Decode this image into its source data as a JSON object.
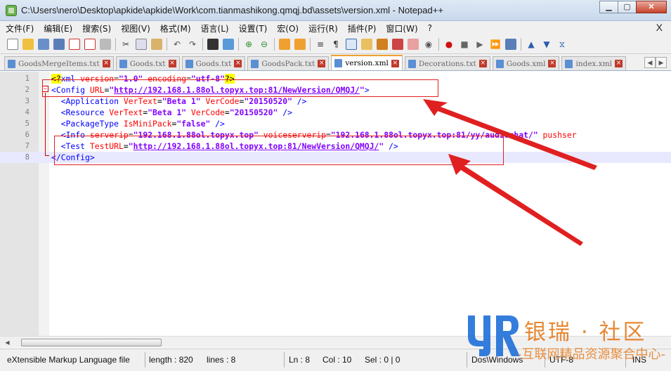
{
  "window": {
    "title": "C:\\Users\\nero\\Desktop\\apkide\\apkide\\Work\\com.tianmashikong.qmqj.bd\\assets\\version.xml - Notepad++",
    "buttons": {
      "minimize": "▁",
      "maximize": "▢",
      "close": "✕"
    }
  },
  "menu": {
    "items": [
      "文件(F)",
      "编辑(E)",
      "搜索(S)",
      "视图(V)",
      "格式(M)",
      "语言(L)",
      "设置(T)",
      "宏(O)",
      "运行(R)",
      "插件(P)",
      "窗口(W)",
      "?"
    ],
    "close": "X"
  },
  "toolbar": {
    "icons": [
      "new-file-icon",
      "open-file-icon",
      "save-icon",
      "save-all-icon",
      "close-icon",
      "close-all-icon",
      "print-icon",
      "cut-icon",
      "copy-icon",
      "paste-icon",
      "undo-icon",
      "redo-icon",
      "find-icon",
      "replace-icon",
      "zoom-in-icon",
      "zoom-out-icon",
      "sync-v-icon",
      "sync-h-icon",
      "wrap-icon",
      "all-chars-icon",
      "indent-guide-icon",
      "lang-icon",
      "map-icon",
      "func-list-icon",
      "folder-icon",
      "monitor-icon",
      "record-icon",
      "stop-icon",
      "play-icon",
      "play-multi-icon",
      "save-macro-icon",
      "up-icon",
      "down-icon",
      "trim-icon"
    ]
  },
  "tabs": [
    {
      "label": "GoodsMergeItems.txt",
      "active": false
    },
    {
      "label": "Goods.txt",
      "active": false
    },
    {
      "label": "Goods.txt",
      "active": false
    },
    {
      "label": "GoodsPack.txt",
      "active": false
    },
    {
      "label": "version.xml",
      "active": true
    },
    {
      "label": "Decorations.txt",
      "active": false
    },
    {
      "label": "Goods.xml",
      "active": false
    },
    {
      "label": "index.xml",
      "active": false
    }
  ],
  "tab_arrows": {
    "left": "◀",
    "right": "▶"
  },
  "editor": {
    "fold_open": "−",
    "lines": [
      {
        "n": "1",
        "parts": [
          [
            "hlq",
            "<?"
          ],
          [
            "tag",
            "xml "
          ],
          [
            "attr",
            "version"
          ],
          [
            "plain",
            "="
          ],
          [
            "val",
            "\"1.0\""
          ],
          [
            "plain",
            " "
          ],
          [
            "attr",
            "encoding"
          ],
          [
            "plain",
            "="
          ],
          [
            "val",
            "\"utf-8\""
          ],
          [
            "hlq",
            "?>"
          ]
        ]
      },
      {
        "n": "2",
        "parts": [
          [
            "tag",
            "<Config "
          ],
          [
            "attr",
            "URL"
          ],
          [
            "plain",
            "="
          ],
          [
            "val",
            "\""
          ],
          [
            "url",
            "http://192.168.1.88ol.topyx.top:81/NewVersion/QMQJ/"
          ],
          [
            "val",
            "\""
          ],
          [
            "tag",
            ">"
          ]
        ]
      },
      {
        "n": "3",
        "parts": [
          [
            "tag",
            "  <Application "
          ],
          [
            "attr",
            "VerText"
          ],
          [
            "plain",
            "="
          ],
          [
            "val",
            "\"Beta 1\""
          ],
          [
            "plain",
            " "
          ],
          [
            "attr",
            "VerCode"
          ],
          [
            "plain",
            "="
          ],
          [
            "val",
            "\"20150520\""
          ],
          [
            "tag",
            " />"
          ]
        ]
      },
      {
        "n": "4",
        "parts": [
          [
            "tag",
            "  <Resource "
          ],
          [
            "attr",
            "VerText"
          ],
          [
            "plain",
            "="
          ],
          [
            "val",
            "\"Beta 1\""
          ],
          [
            "plain",
            " "
          ],
          [
            "attr",
            "VerCode"
          ],
          [
            "plain",
            "="
          ],
          [
            "val",
            "\"20150520\""
          ],
          [
            "tag",
            " />"
          ]
        ]
      },
      {
        "n": "5",
        "parts": [
          [
            "tag",
            "  <PackageType "
          ],
          [
            "attr",
            "IsMiniPack"
          ],
          [
            "plain",
            "="
          ],
          [
            "val",
            "\"false\""
          ],
          [
            "tag",
            " />"
          ]
        ]
      },
      {
        "n": "6",
        "parts": [
          [
            "tag",
            "  <Info "
          ],
          [
            "attr",
            "serverip"
          ],
          [
            "plain",
            "="
          ],
          [
            "val",
            "\"192.168.1.88ol.topyx.top\""
          ],
          [
            "plain",
            " "
          ],
          [
            "attr",
            "voiceserverip"
          ],
          [
            "plain",
            "="
          ],
          [
            "val",
            "\"192.168.1.88ol.topyx.top:81/yy/audiochat/\""
          ],
          [
            "plain",
            " "
          ],
          [
            "attr",
            "pushser"
          ]
        ]
      },
      {
        "n": "7",
        "parts": [
          [
            "tag",
            "  <Test "
          ],
          [
            "attr",
            "TestURL"
          ],
          [
            "plain",
            "="
          ],
          [
            "val",
            "\""
          ],
          [
            "url",
            "http://192.168.1.88ol.topyx.top:81/NewVersion/QMQJ/"
          ],
          [
            "val",
            "\""
          ],
          [
            "tag",
            " />"
          ]
        ]
      },
      {
        "n": "8",
        "parts": [
          [
            "tag",
            "</Config"
          ],
          [
            "tag",
            ">"
          ]
        ]
      }
    ]
  },
  "scrollbar": {
    "left": "◀",
    "right": "▶"
  },
  "status": {
    "filetype": "eXtensible Markup Language file",
    "length": "length : 820",
    "lines": "lines : 8",
    "ln": "Ln : 8",
    "col": "Col : 10",
    "sel": "Sel : 0 | 0",
    "eol": "Dos\\Windows",
    "encoding": "UTF-8",
    "mode": "INS"
  },
  "watermark": {
    "title": "银瑞 · 社区",
    "subtitle": "-互联网精品资源聚合中心-"
  },
  "colors": {
    "annotation": "#e02020",
    "watermark": "#e67e22",
    "watermark_blue": "#1e6fd9"
  }
}
